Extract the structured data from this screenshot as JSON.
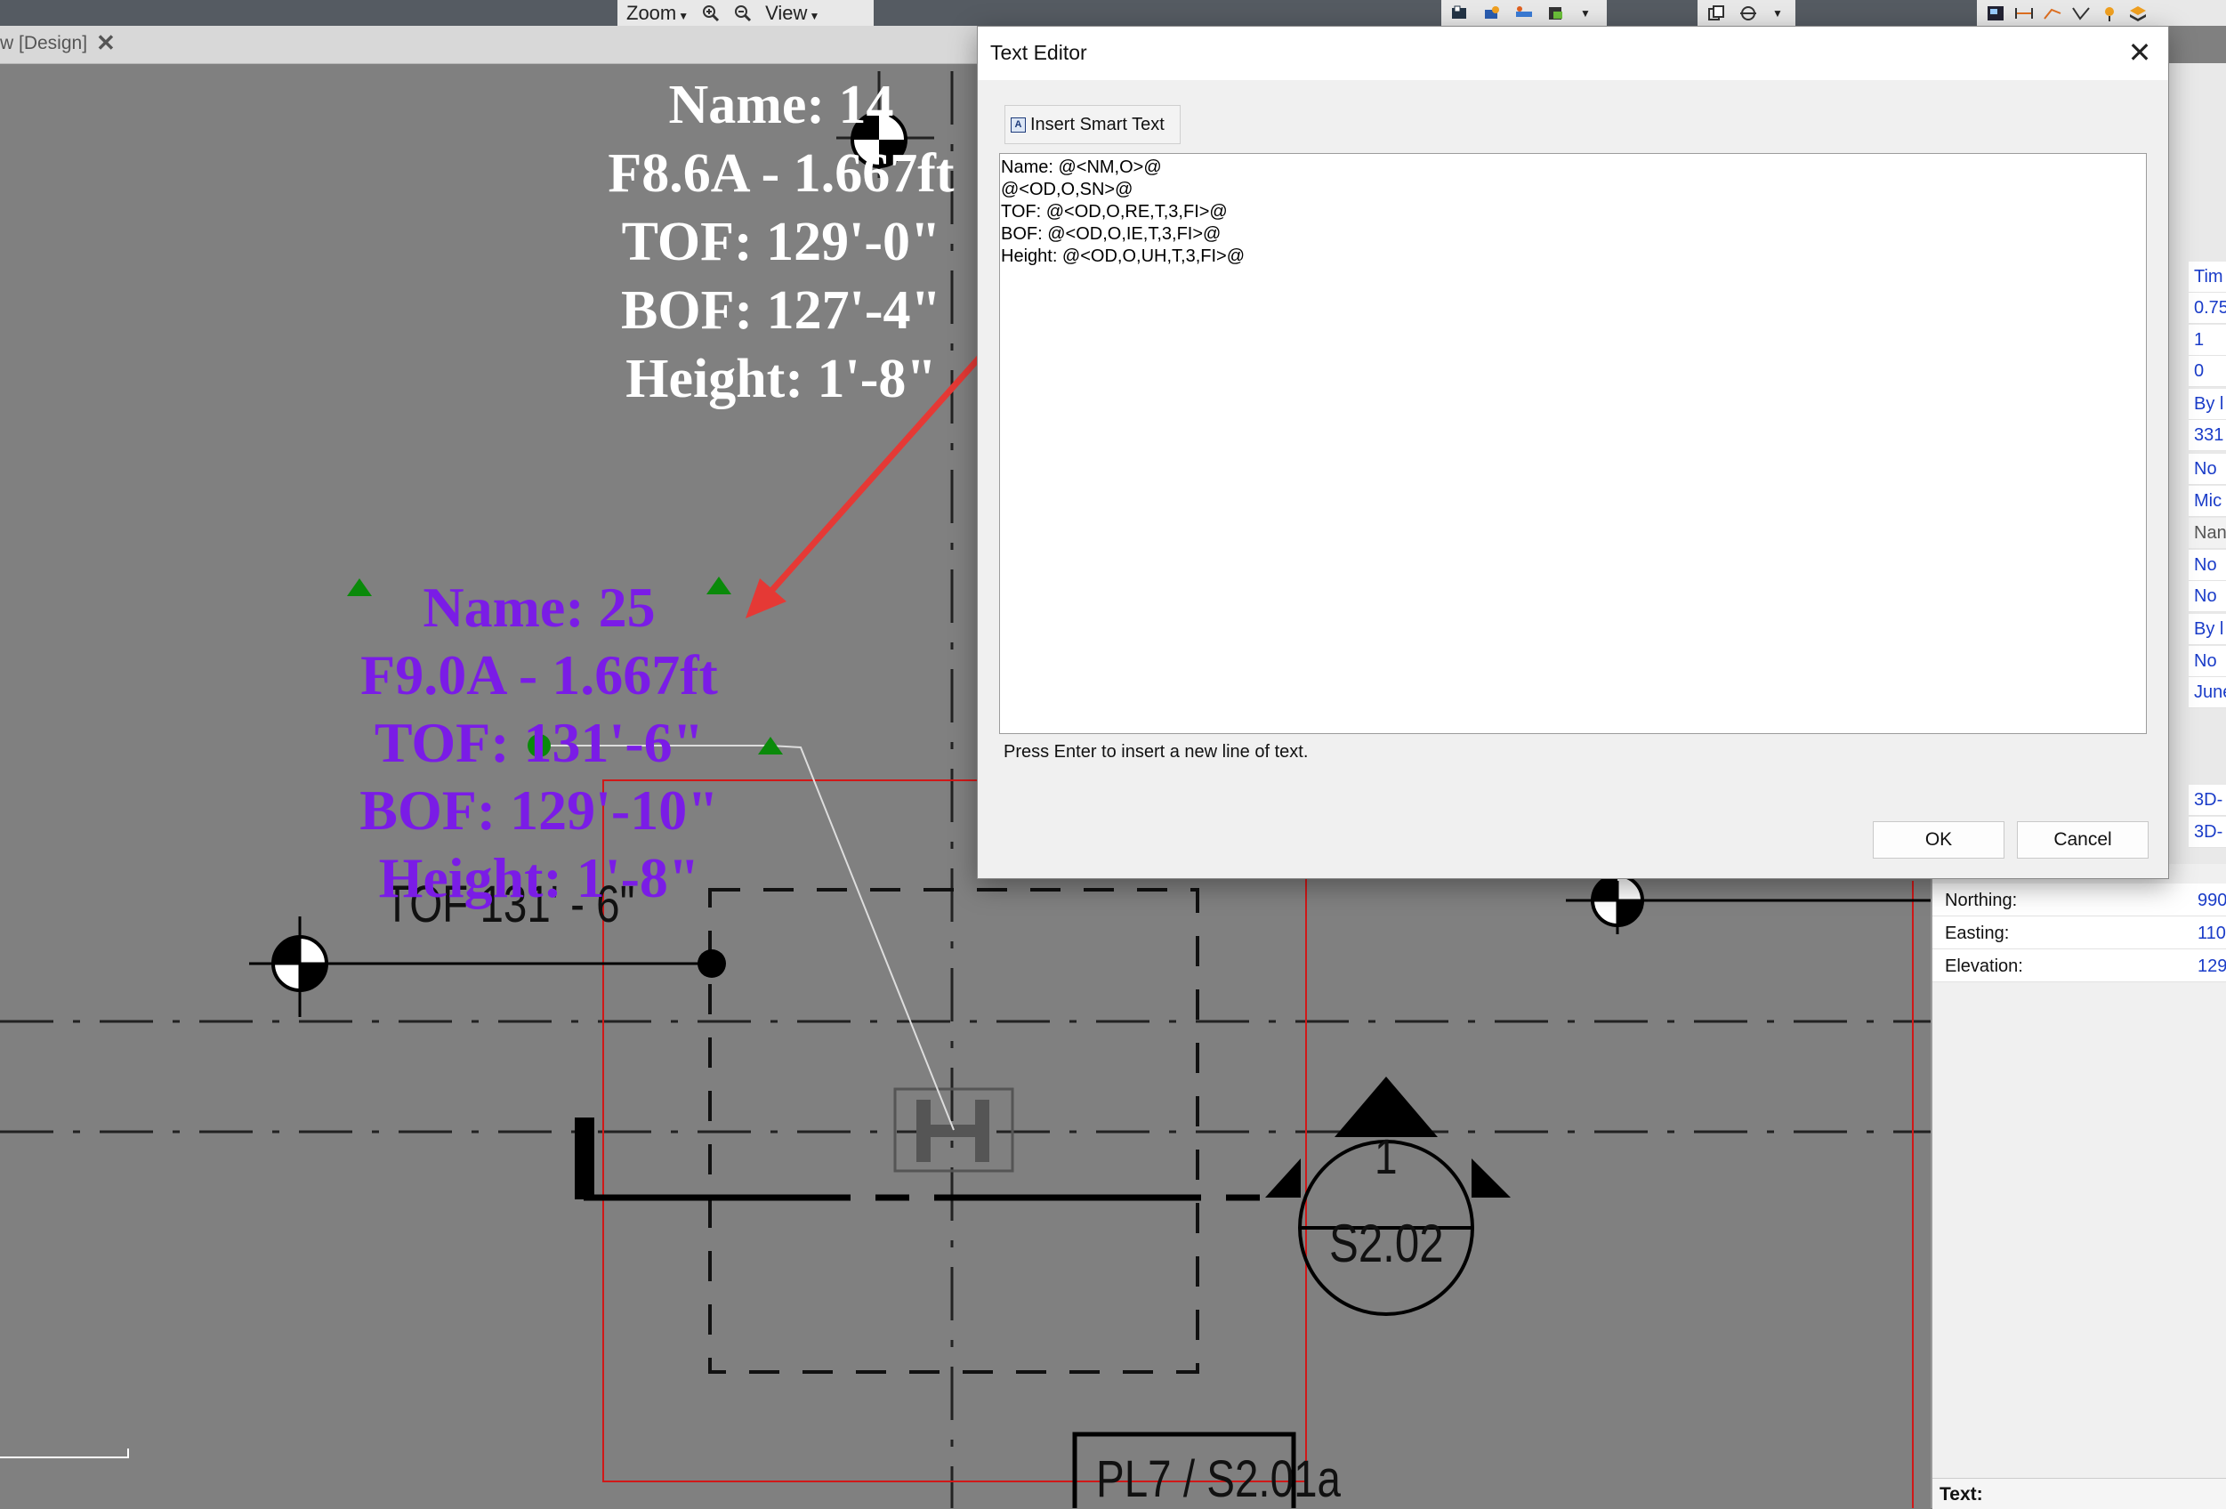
{
  "toolbar": {
    "zoom_label": "Zoom",
    "view_label": "View"
  },
  "tab": {
    "label": "w [Design]",
    "close_glyph": "✕"
  },
  "drawing": {
    "existing_label": {
      "lines": [
        "Name: 14",
        "F8.6A - 1.667ft",
        "TOF: 129'-0\"",
        "BOF: 127'-4\"",
        "Height: 1'-8\""
      ],
      "color": "#ffffff"
    },
    "selected_label": {
      "lines": [
        "Name: 25",
        "F9.0A - 1.667ft",
        "TOF: 131'-6\"",
        "BOF: 129'-10\"",
        "Height: 1'-8\""
      ],
      "color": "#7a1ce6"
    },
    "cad_texts": {
      "tof_note": "TOF 131' - 6\"",
      "section_number": "1",
      "section_sheet": "S2.02",
      "detail_tag": "PL7 / S2.01a"
    },
    "annotation_arrow_color": "#e53935",
    "grip_color": "#0a8a0a"
  },
  "properties": {
    "right_values": [
      "Tim",
      "0.75",
      "1",
      "0",
      "By l",
      "331",
      "No",
      "Mic",
      "Nan",
      "No",
      "No",
      "By l",
      "No",
      "June",
      "3D-",
      "3D-"
    ],
    "rows": [
      {
        "label": "Northing:",
        "value": "990"
      },
      {
        "label": "Easting:",
        "value": "110"
      },
      {
        "label": "Elevation:",
        "value": "129"
      }
    ],
    "text_label": "Text:"
  },
  "dialog": {
    "title": "Text Editor",
    "close_glyph": "✕",
    "insert_button": "Insert Smart Text",
    "editor_lines": [
      "Name: @<NM,O>@",
      "@<OD,O,SN>@",
      "TOF: @<OD,O,RE,T,3,FI>@",
      "BOF: @<OD,O,IE,T,3,FI>@",
      "Height: @<OD,O,UH,T,3,FI>@"
    ],
    "hint": "Press Enter to insert a new line of text.",
    "ok_button": "OK",
    "cancel_button": "Cancel"
  }
}
